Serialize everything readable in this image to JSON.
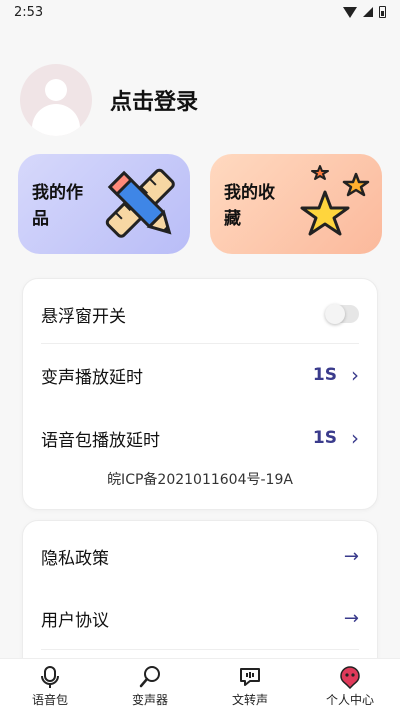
{
  "status_bar": {
    "time": "2:53",
    "icons": [
      "wifi-icon",
      "signal-icon",
      "battery-icon"
    ]
  },
  "profile": {
    "login_label": "点击登录",
    "avatar_icon": "user-avatar-icon"
  },
  "shortcuts": [
    {
      "label": "我的作品",
      "icon": "pencil-ruler-icon",
      "color": "#c3c5f9"
    },
    {
      "label": "我的收藏",
      "icon": "stars-icon",
      "color": "#fcc4a6"
    }
  ],
  "settings": {
    "float_window": {
      "label": "悬浮窗开关",
      "enabled": false
    },
    "voice_change_delay": {
      "label": "变声播放延时",
      "value": "1S"
    },
    "voice_pack_delay": {
      "label": "语音包播放延时",
      "value": "1S"
    },
    "icp": "皖ICP备2021011604号-19A"
  },
  "links": [
    {
      "label": "隐私政策"
    },
    {
      "label": "用户协议"
    }
  ],
  "tabs": [
    {
      "label": "语音包",
      "icon": "microphone-icon",
      "active": false
    },
    {
      "label": "变声器",
      "icon": "voice-changer-icon",
      "active": false
    },
    {
      "label": "文转声",
      "icon": "text-to-speech-icon",
      "active": false
    },
    {
      "label": "个人中心",
      "icon": "profile-icon",
      "active": true
    }
  ],
  "colors": {
    "accent": "#3a3b8c",
    "active_tab": "#e03a5a"
  }
}
